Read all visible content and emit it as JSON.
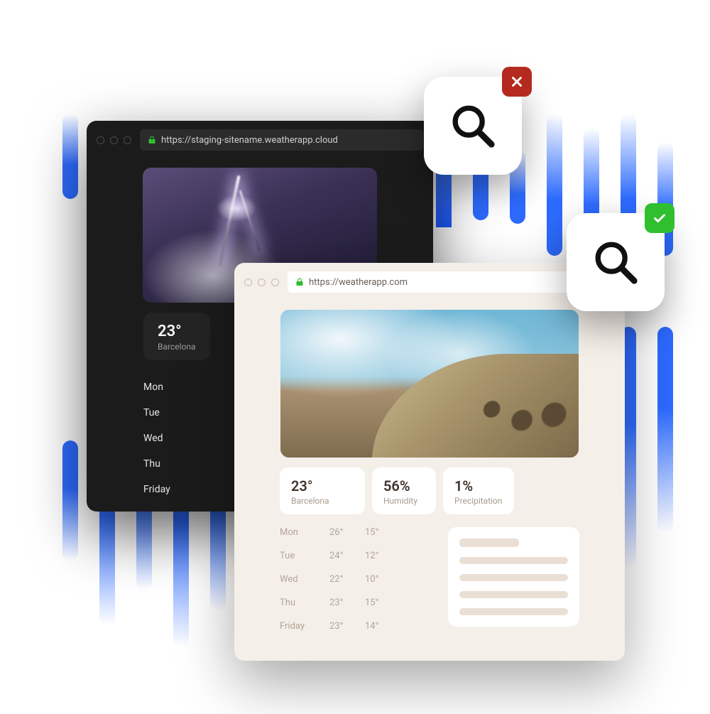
{
  "dark_window": {
    "url": "https://staging-sitename.weatherapp.cloud",
    "main_card": {
      "temp": "23°",
      "location": "Barcelona"
    },
    "days": [
      "Mon",
      "Tue",
      "Wed",
      "Thu",
      "Friday"
    ]
  },
  "light_window": {
    "url": "https://weatherapp.com",
    "cards": [
      {
        "value": "23°",
        "label": "Barcelona"
      },
      {
        "value": "56%",
        "label": "Humidity"
      },
      {
        "value": "1%",
        "label": "Precipitation"
      }
    ],
    "forecast": [
      {
        "day": "Mon",
        "hi": "26°",
        "lo": "15°"
      },
      {
        "day": "Tue",
        "hi": "24°",
        "lo": "12°"
      },
      {
        "day": "Wed",
        "hi": "22°",
        "lo": "10°"
      },
      {
        "day": "Thu",
        "hi": "23°",
        "lo": "15°"
      },
      {
        "day": "Friday",
        "hi": "23°",
        "lo": "14°"
      }
    ]
  }
}
